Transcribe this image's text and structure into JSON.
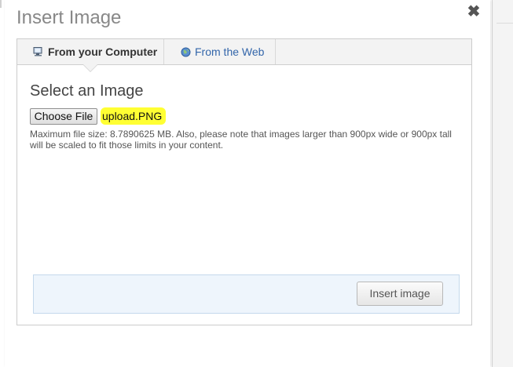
{
  "dialog": {
    "title": "Insert Image",
    "close_icon": "close-icon"
  },
  "tabs": [
    {
      "label": "From your Computer",
      "icon": "computer-icon",
      "active": true
    },
    {
      "label": "From the Web",
      "icon": "globe-icon",
      "active": false
    }
  ],
  "upload": {
    "heading": "Select an Image",
    "choose_file_label": "Choose File",
    "file_name": "upload.PNG",
    "file_name_highlight": "#ffff33",
    "note": "Maximum file size: 8.7890625 MB. Also, please note that images larger than 900px wide or 900px tall will be scaled to fit those limits in your content."
  },
  "footer": {
    "insert_label": "Insert image"
  },
  "colors": {
    "link": "#3366aa",
    "footer_bg": "#eef5fc"
  }
}
